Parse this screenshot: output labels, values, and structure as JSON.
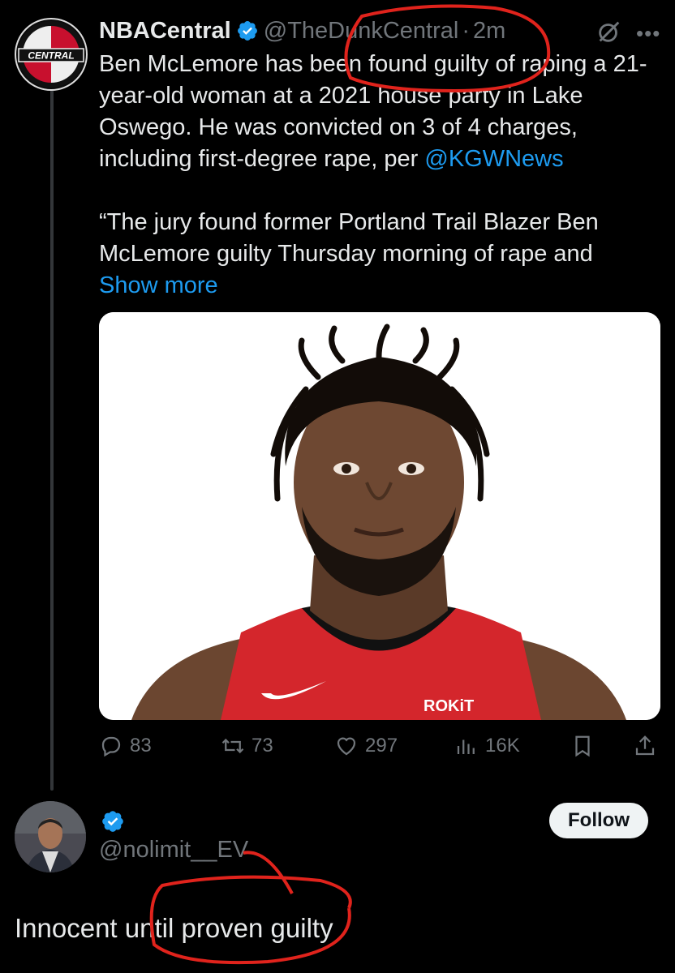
{
  "tweet": {
    "author_name": "NBACentral",
    "handle": "@TheDunkCentral",
    "dot": "·",
    "time": "2m",
    "avatar_label": "CENTRAL",
    "body_line1": "Ben McLemore has been found guilty of raping a 21-year-old woman at a 2021 house party in Lake Oswego. He was convicted on 3 of 4 charges, including first-degree rape, per ",
    "mention": "@KGWNews",
    "body_line2": "“The jury found former Portland Trail Blazer Ben McLemore guilty Thursday morning of rape and ",
    "show_more": "Show more",
    "jersey_text": "ROKiT",
    "actions": {
      "replies": "83",
      "reposts": "73",
      "likes": "297",
      "views": "16K"
    }
  },
  "reply": {
    "handle": "@nolimit__EV",
    "follow_label": "Follow",
    "text": "Innocent until proven guilty"
  },
  "colors": {
    "accent": "#1d9bf0",
    "annotation": "#e0231c",
    "muted": "#71767b"
  },
  "icons": [
    "verified-badge-icon",
    "grok-icon",
    "more-icon",
    "reply-icon",
    "repost-icon",
    "like-icon",
    "views-icon",
    "bookmark-icon",
    "share-icon"
  ]
}
